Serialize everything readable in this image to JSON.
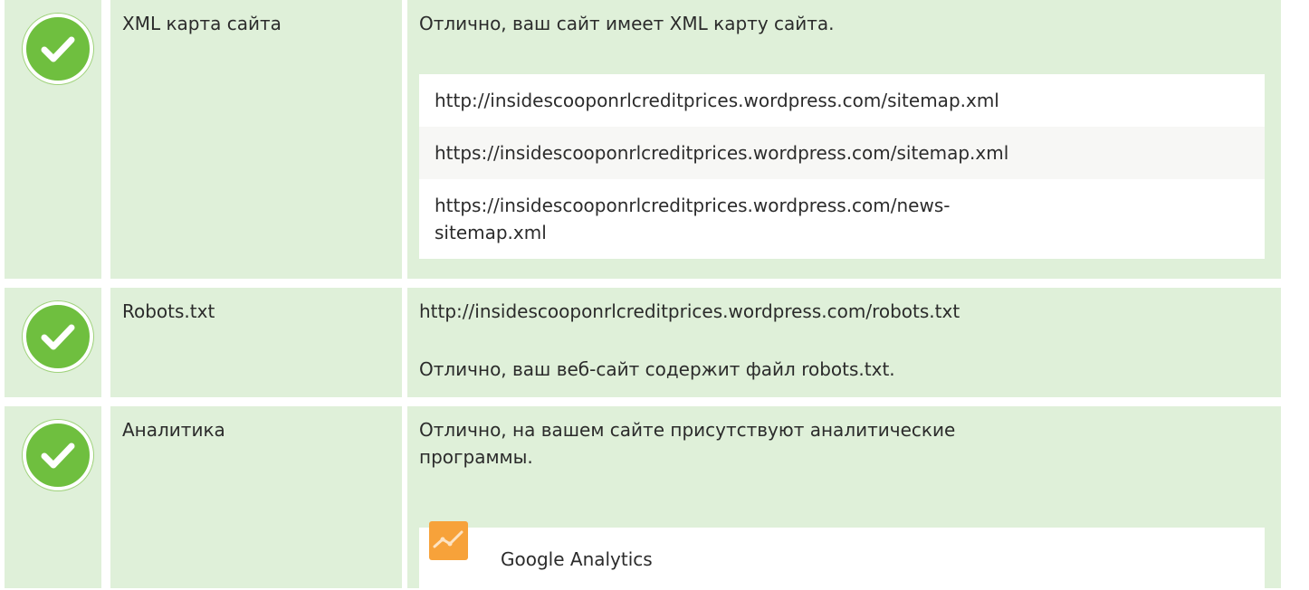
{
  "rows": [
    {
      "label": "XML карта сайта",
      "message": "Отлично, ваш сайт имеет XML карту сайта.",
      "urls": [
        "http://insidescooponrlcreditprices.wordpress.com/sitemap.xml",
        "https://insidescooponrlcreditprices.wordpress.com/sitemap.xml",
        "https://insidescooponrlcreditprices.wordpress.com/news-sitemap.xml"
      ],
      "status_icon": "check-circle-icon"
    },
    {
      "label": "Robots.txt",
      "url": "http://insidescooponrlcreditprices.wordpress.com/robots.txt",
      "message": "Отлично, ваш веб-сайт содержит файл robots.txt.",
      "status_icon": "check-circle-icon"
    },
    {
      "label": "Аналитика",
      "message": "Отлично, на вашем сайте присутствуют аналитические программы.",
      "tool": {
        "name": "Google Analytics",
        "icon": "google-analytics-icon"
      },
      "status_icon": "check-circle-icon"
    }
  ],
  "colors": {
    "row_background": "#dff0d9",
    "check_green": "#6fbf3f",
    "analytics_orange": "#f7a23a"
  }
}
